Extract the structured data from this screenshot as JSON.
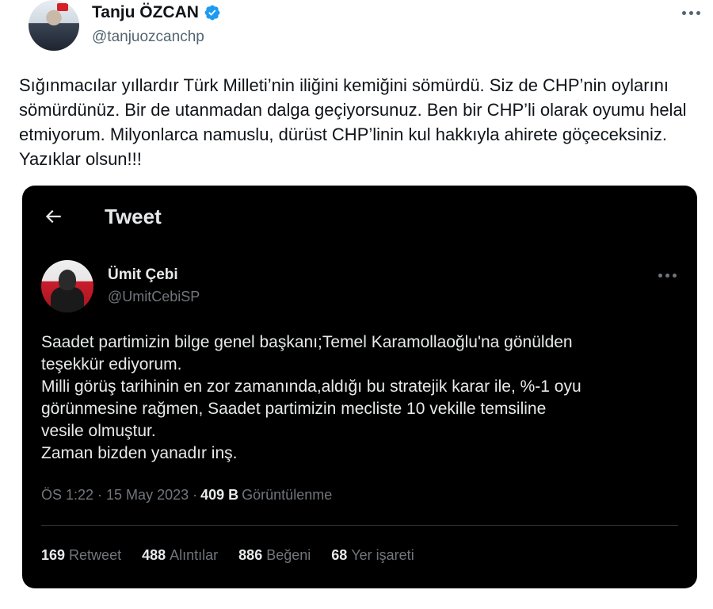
{
  "outer_tweet": {
    "author_name": "Tanju ÖZCAN",
    "author_handle": "@tanjuozcanchp",
    "verified": true,
    "text": "Sığınmacılar yıllardır Türk Milleti’nin iliğini kemiğini sömürdü. Siz de CHP’nin oylarını sömürdünüz. Bir de utanmadan dalga geçiyorsunuz. Ben bir CHP’li olarak oyumu helal etmiyorum. Milyonlarca namuslu, dürüst CHP’linin kul hakkıyla ahirete göçeceksiniz. Yazıklar olsun!!!"
  },
  "embedded": {
    "header_title": "Tweet",
    "author_name": "Ümit Çebi",
    "author_handle": "@UmitCebiSP",
    "text_lines": [
      "Saadet partimizin bilge genel başkanı;Temel Karamollaoğlu'na gönülden",
      "teşekkür ediyorum.",
      "Milli görüş tarihinin en zor zamanında,aldığı bu stratejik karar ile, %-1 oyu",
      "görünmesine rağmen, Saadet partimizin mecliste 10 vekille temsiline",
      "vesile olmuştur.",
      "Zaman bizden yanadır inş."
    ],
    "meta": {
      "time_date": "ÖS 1:22 · 15 May 2023 ·",
      "views_count": "409 B",
      "views_label": "Görüntülenme"
    },
    "stats": [
      {
        "count": "169",
        "label": "Retweet"
      },
      {
        "count": "488",
        "label": "Alıntılar"
      },
      {
        "count": "886",
        "label": "Beğeni"
      },
      {
        "count": "68",
        "label": "Yer işareti"
      }
    ]
  },
  "colors": {
    "verified_blue": "#1d9bf0",
    "dark_bg": "#000000",
    "dark_text": "#e7e9ea",
    "dark_secondary": "#71767b"
  }
}
